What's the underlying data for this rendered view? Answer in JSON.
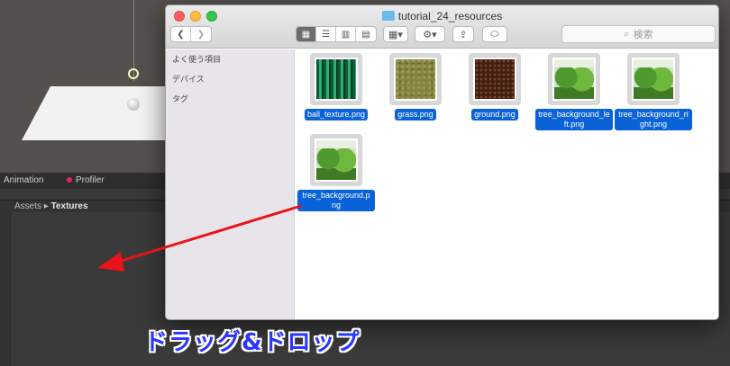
{
  "unity": {
    "tab_animation": "Animation",
    "tab_profiler": "Profiler",
    "breadcrumb_root": "Assets",
    "breadcrumb_sep": "▸",
    "breadcrumb_current": "Textures"
  },
  "finder": {
    "title": "tutorial_24_resources",
    "search_placeholder": "検索",
    "sidebar": [
      "よく使う項目",
      "デバイス",
      "タグ"
    ],
    "files": [
      {
        "name": "ball_texture.png",
        "thumb": "ball-texture"
      },
      {
        "name": "grass.png",
        "thumb": "grass-texture"
      },
      {
        "name": "ground.png",
        "thumb": "ground-texture"
      },
      {
        "name": "tree_background_left.png",
        "thumb": "tree-image"
      },
      {
        "name": "tree_background_right.png",
        "thumb": "tree-image"
      },
      {
        "name": "tree_background.png",
        "thumb": "tree-image"
      }
    ]
  },
  "annotation": {
    "text": "ドラッグ&ドロップ",
    "arrow_color": "#e8141a",
    "text_color": "#2a36ff"
  }
}
